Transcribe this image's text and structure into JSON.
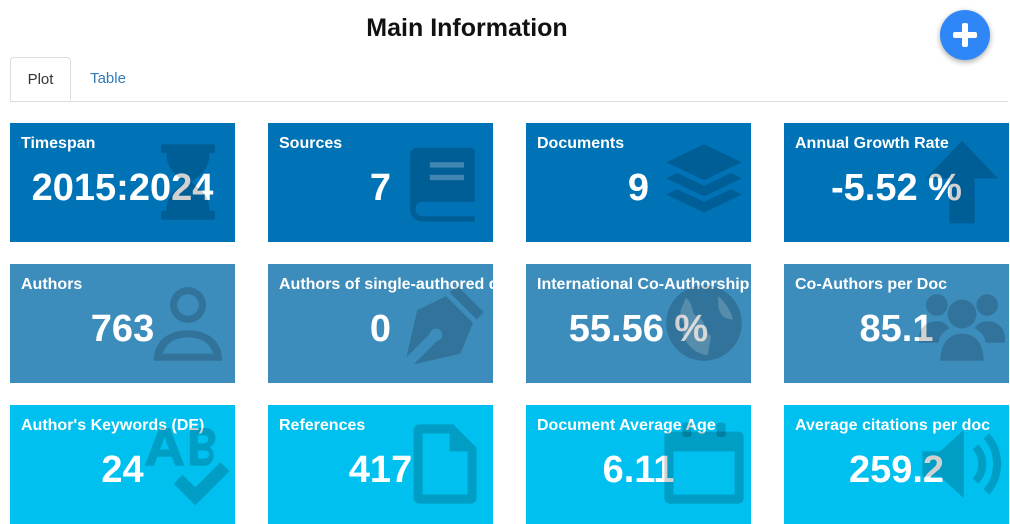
{
  "page": {
    "title": "Main Information"
  },
  "fab": {
    "icon": "plus-icon"
  },
  "tabs": [
    {
      "label": "Plot",
      "active": true
    },
    {
      "label": "Table",
      "active": false
    }
  ],
  "colors": {
    "dark": "#0073b7",
    "mid": "#3c8dbc",
    "light": "#00c0ef",
    "fab": "#2f86f6",
    "tab_link": "#337ab7"
  },
  "boxes": [
    {
      "label": "Timespan",
      "value": "2015:2024",
      "icon": "hourglass-icon"
    },
    {
      "label": "Sources",
      "value": "7",
      "icon": "book-icon"
    },
    {
      "label": "Documents",
      "value": "9",
      "icon": "layer-group-icon"
    },
    {
      "label": "Annual Growth Rate",
      "value": "-5.52 %",
      "icon": "arrow-up-icon"
    },
    {
      "label": "Authors",
      "value": "763",
      "icon": "user-icon"
    },
    {
      "label": "Authors of single-authored docs",
      "value": "0",
      "icon": "pen-nib-icon"
    },
    {
      "label": "International Co-Authorship",
      "value": "55.56 %",
      "icon": "globe-icon"
    },
    {
      "label": "Co-Authors per Doc",
      "value": "85.1",
      "icon": "users-icon"
    },
    {
      "label": "Author's Keywords (DE)",
      "value": "24",
      "icon": "spell-check-icon"
    },
    {
      "label": "References",
      "value": "417",
      "icon": "file-icon"
    },
    {
      "label": "Document Average Age",
      "value": "6.11",
      "icon": "calendar-icon"
    },
    {
      "label": "Average citations per doc",
      "value": "259.2",
      "icon": "volume-icon"
    }
  ]
}
